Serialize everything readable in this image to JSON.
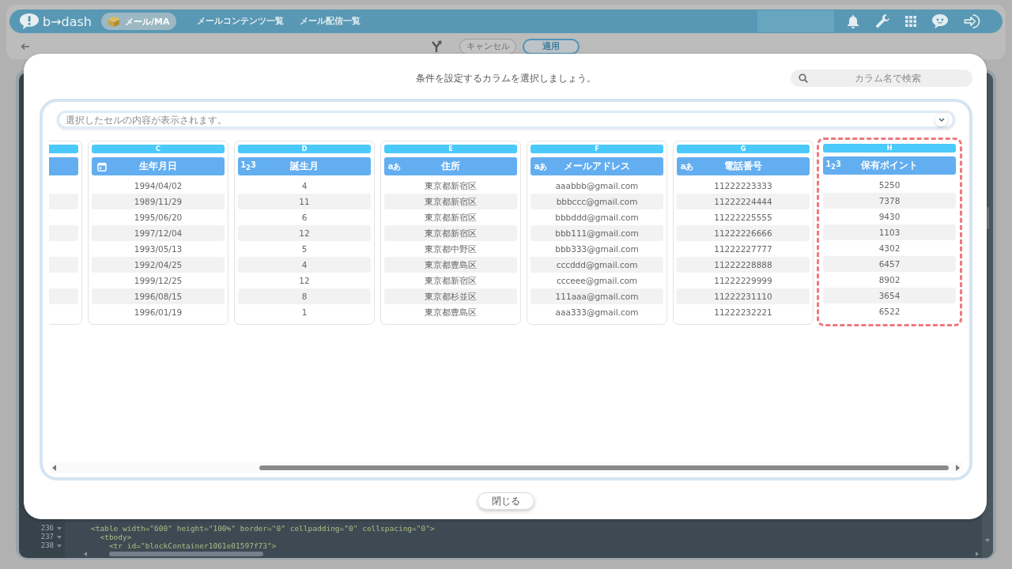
{
  "app_header": {
    "logo_text": "b→dash",
    "module_button": "メール/MA",
    "nav_links": [
      "メールコンテンツ一覧",
      "メール配信一覧"
    ]
  },
  "sub_bar": {
    "buttons": [
      {
        "label": "キャンセル",
        "kind": "secondary"
      },
      {
        "label": "適用",
        "kind": "primary"
      }
    ]
  },
  "code_editor": {
    "lines": [
      {
        "number": "236",
        "code": "<table width=\"600\" height=\"100%\" border=\"0\" cellpadding=\"0\" cellspacing=\"0\">"
      },
      {
        "number": "237",
        "code": "  <tbody>"
      },
      {
        "number": "238",
        "code": "    <tr id=\"blockContainer1061e01597f73\">"
      }
    ]
  },
  "dialog": {
    "title": "条件を設定するカラムを選択しましょう。",
    "search": {
      "placeholder": "カラム名で検索"
    },
    "cell_preview": {
      "placeholder": "選択したセルの内容が表示されます。"
    },
    "columns": [
      {
        "letter": "C",
        "title": "生年月日",
        "kind": "date",
        "selected": false,
        "cells": [
          "1994/04/02",
          "1989/11/29",
          "1995/06/20",
          "1997/12/04",
          "1993/05/13",
          "1992/04/25",
          "1999/12/25",
          "1996/08/15",
          "1996/01/19"
        ]
      },
      {
        "letter": "D",
        "title": "誕生月",
        "kind": "number",
        "type_glyph": "1$_{2}$3",
        "selected": false,
        "cells": [
          "4",
          "11",
          "6",
          "12",
          "5",
          "4",
          "12",
          "8",
          "1"
        ]
      },
      {
        "letter": "E",
        "title": "住所",
        "kind": "text",
        "type_glyph": "aあ",
        "selected": false,
        "cells": [
          "東京都新宿区",
          "東京都新宿区",
          "東京都新宿区",
          "東京都新宿区",
          "東京都中野区",
          "東京都豊島区",
          "東京都新宿区",
          "東京都杉並区",
          "東京都豊島区"
        ]
      },
      {
        "letter": "F",
        "title": "メールアドレス",
        "kind": "text",
        "type_glyph": "aあ",
        "selected": false,
        "cells": [
          "aaabbb@gmail.com",
          "bbbccc@gmail.com",
          "bbbddd@gmail.com",
          "bbb111@gmail.com",
          "bbb333@gmail.com",
          "cccddd@gmail.com",
          "ccceee@gmail.com",
          "111aaa@gmail.com",
          "aaa333@gmail.com"
        ]
      },
      {
        "letter": "G",
        "title": "電話番号",
        "kind": "text",
        "type_glyph": "aあ",
        "selected": false,
        "cells": [
          "11222223333",
          "11222224444",
          "11222225555",
          "11222226666",
          "11222227777",
          "11222228888",
          "11222229999",
          "11222231110",
          "11222232221"
        ]
      },
      {
        "letter": "H",
        "title": "保有ポイント",
        "kind": "number",
        "type_glyph": "1$_{2}$3",
        "selected": true,
        "cells": [
          "5250",
          "7378",
          "9430",
          "1103",
          "4302",
          "6457",
          "8902",
          "3654",
          "6522"
        ]
      }
    ],
    "close_button": "閉じる"
  }
}
